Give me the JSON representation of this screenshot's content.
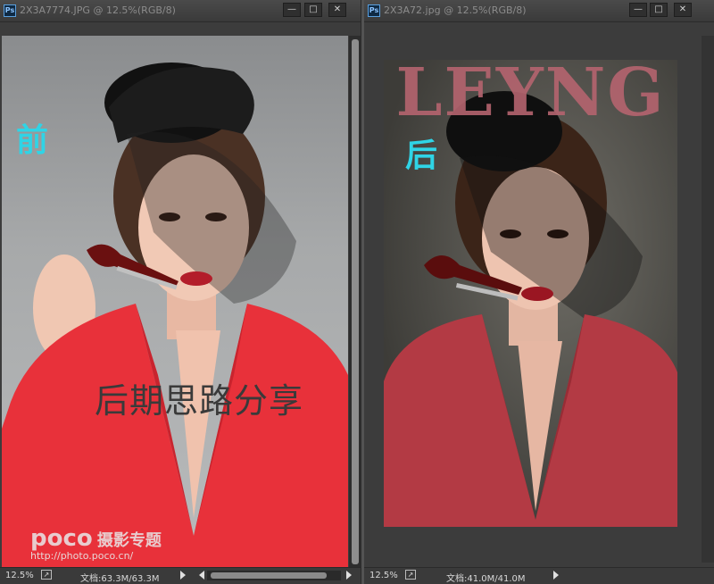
{
  "left_window": {
    "title": "2X3A7774.JPG @ 12.5%(RGB/8)",
    "zoom": "12.5%",
    "doc_info": "文档:63.3M/63.3M",
    "label_before": "前",
    "caption": "后期思路分享",
    "watermark_logo": "poco",
    "watermark_brand": "摄影专题",
    "watermark_url": "http://photo.poco.cn/"
  },
  "right_window": {
    "title": "2X3A72.jpg @ 12.5%(RGB/8)",
    "zoom": "12.5%",
    "doc_info": "文档:41.0M/41.0M",
    "label_after": "后",
    "masthead": "LEYNG"
  },
  "controls": {
    "minimize": "—",
    "maximize": "□",
    "close": "✕"
  },
  "colors": {
    "label_cyan": "#2fd4e6",
    "masthead": "#b5646f",
    "jacket_red": "#e8313a",
    "jacket_muted": "#b33a44"
  }
}
